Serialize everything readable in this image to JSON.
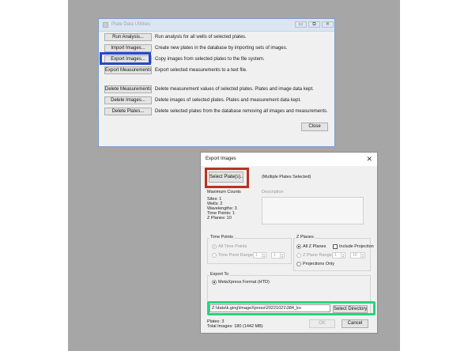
{
  "utilities_window": {
    "title": "Plate Data Utilities",
    "controls": {
      "minimize": "▭",
      "restore": "⧉",
      "close": "✕"
    },
    "actions": [
      {
        "label": "Run Analysis...",
        "description": "Run analysis for all wells of selected plates."
      },
      {
        "label": "Import Images...",
        "description": "Create new plates in the database by importing sets of images."
      },
      {
        "label": "Export Images...",
        "description": "Copy images from selected plates to the file system."
      },
      {
        "label": "Export Measurements...",
        "description": "Export selected measurements to a text file."
      },
      {
        "label": "Delete Measurements...",
        "description": "Delete measurement values of selected plates. Plates and image data kept."
      },
      {
        "label": "Delete Images...",
        "description": "Delete images of selected plates. Plates and measurement data kept."
      },
      {
        "label": "Delete Plates...",
        "description": "Delete selected plates from the database removing all images and measurements."
      }
    ],
    "close_label": "Close"
  },
  "export_dialog": {
    "title": "Export Images",
    "close_glyph": "✕",
    "select_plates_label": "Select Plate(s)...",
    "selection_status": "(Multiple Plates Selected)",
    "maximum_counts": {
      "heading": "Maximum Counts",
      "lines": [
        "Sites: 1",
        "Wells: 2",
        "Wavelengths: 3",
        "Time Points: 1",
        "Z Planes: 10"
      ]
    },
    "description_label": "Description",
    "time_points": {
      "heading": "Time Points",
      "all_label": "All Time Points",
      "range_label": "Time Point Range",
      "range_from": "1",
      "range_to": "1"
    },
    "z_planes": {
      "heading": "Z Planes",
      "all_label": "All Z Planes",
      "include_projection_label": "Include Projection",
      "range_label": "Z Plane Range",
      "range_from": "1",
      "range_to": "10",
      "projections_only_label": "Projections Only"
    },
    "export_to": {
      "heading": "Export To",
      "format_label": "MetaXpress Format (HTD)",
      "path_value": "Z:\\data\\k.ging\\ImageXpress\\20221021\\384_ko",
      "select_directory_label": "Select Directory..."
    },
    "summary": {
      "plates": "Plates: 3",
      "total_images": "Total Images: 180 (1442 MB)"
    },
    "ok_label": "OK",
    "cancel_label": "Cancel"
  },
  "highlight_colors": {
    "export_images": "#2449c8",
    "select_plates": "#b83222",
    "export_path": "#27d47e"
  }
}
